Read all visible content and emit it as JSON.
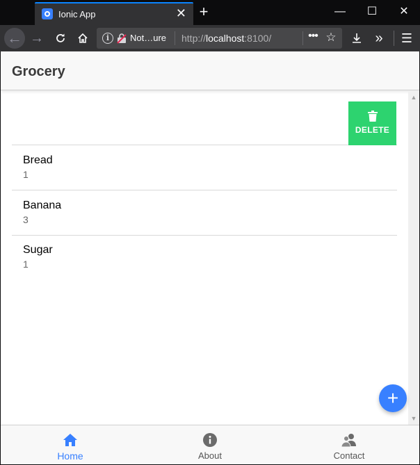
{
  "browser": {
    "tab_title": "Ionic App",
    "tab_close": "✕",
    "new_tab": "+",
    "win_min": "—",
    "win_max": "☐",
    "win_close": "✕",
    "url_secure_text": "Not…ure",
    "url_prefix": "http://",
    "url_host": "localhost",
    "url_suffix": ":8100/",
    "url_more": "•••",
    "accent": "#0a84ff"
  },
  "app": {
    "title": "Grocery",
    "delete_label": "DELETE",
    "items": [
      {
        "name": "Bread",
        "quantity": "1"
      },
      {
        "name": "Banana",
        "quantity": "3"
      },
      {
        "name": "Sugar",
        "quantity": "1"
      }
    ],
    "fab_label": "+",
    "tabs": [
      {
        "label": "Home",
        "icon": "home-icon",
        "active": true
      },
      {
        "label": "About",
        "icon": "information-circle-icon",
        "active": false
      },
      {
        "label": "Contact",
        "icon": "contacts-icon",
        "active": false
      }
    ],
    "colors": {
      "primary": "#3880ff",
      "success": "#2dd36f",
      "toolbar": "#f8f8f8"
    }
  }
}
